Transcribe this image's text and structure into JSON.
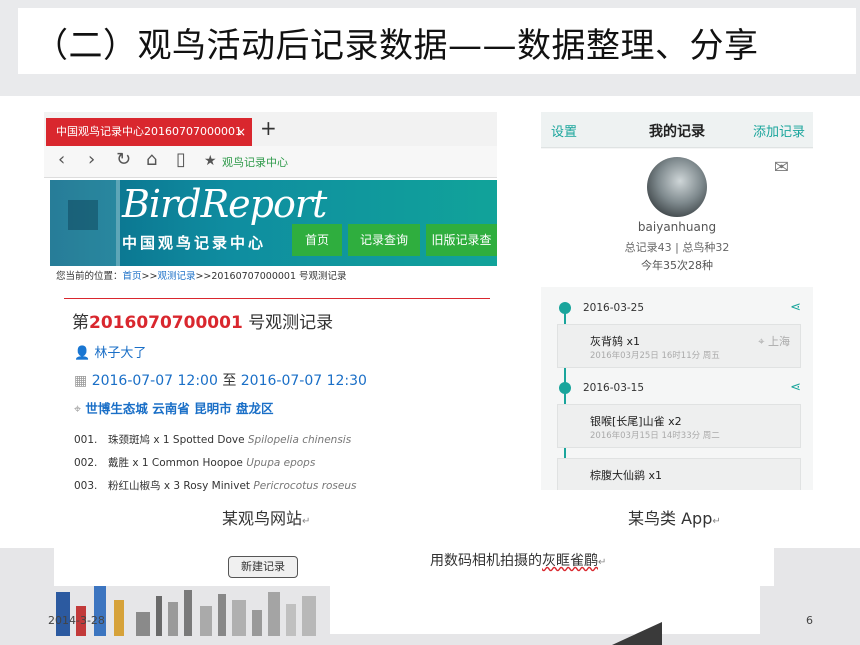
{
  "slide": {
    "title": "（二）观鸟活动后记录数据——数据整理、分享",
    "date": "2014-3-28",
    "page": "6"
  },
  "website": {
    "tab_title": "中国观鸟记录中心20160707000001",
    "tab_close": "×",
    "new_tab": "+",
    "address_bar": "观鸟记录中心",
    "logo_text": "BirdReport",
    "logo_subtitle": "中国观鸟记录中心",
    "nav": [
      "首页",
      "记录查询",
      "旧版记录查"
    ],
    "breadcrumb": {
      "prefix": "您当前的位置：",
      "home": "首页",
      "sep": ">>",
      "section": "观测记录",
      "current": "20160707000001 号观测记录"
    },
    "record": {
      "title_prefix": "第",
      "number": "2016070700001",
      "title_suffix": "号观测记录",
      "user": "林子大了",
      "start": "2016-07-07 12:00",
      "to": "至",
      "end": "2016-07-07 12:30",
      "location": "世博生态城 云南省 昆明市 盘龙区"
    },
    "species": [
      {
        "idx": "001.",
        "name": "珠颈斑鸠 x 1 Spotted Dove",
        "sci": "Spilopelia chinensis"
      },
      {
        "idx": "002.",
        "name": "戴胜 x 1 Common Hoopoe",
        "sci": "Upupa epops"
      },
      {
        "idx": "003.",
        "name": "粉红山椒鸟 x 3 Rosy Minivet",
        "sci": "Pericrocotus roseus"
      }
    ]
  },
  "app": {
    "left_action": "设置",
    "title": "我的记录",
    "right_action": "添加记录",
    "username": "baiyanhuang",
    "stats": "总记录43 | 总鸟种32",
    "year_stats": "今年35次28种",
    "entries": [
      {
        "date": "2016-03-25",
        "name": "灰背鸫 x1",
        "meta": "2016年03月25日 16时11分 周五",
        "place": "上海"
      },
      {
        "date": "2016-03-15",
        "name": "银喉[长尾]山雀 x2",
        "meta": "2016年03月15日 14时33分 周二",
        "place": ""
      },
      {
        "date": "",
        "name": "棕腹大仙鹟 x1",
        "meta": "",
        "place": ""
      }
    ]
  },
  "captions": {
    "website": "某观鸟网站",
    "app": "某鸟类 App",
    "return_mark": "↵"
  },
  "bottom": {
    "new_record_button": "新建记录",
    "photo_caption_before": "用数码相机拍摄的",
    "photo_caption_bird": "灰眶雀鹛",
    "return_mark": "↵"
  }
}
